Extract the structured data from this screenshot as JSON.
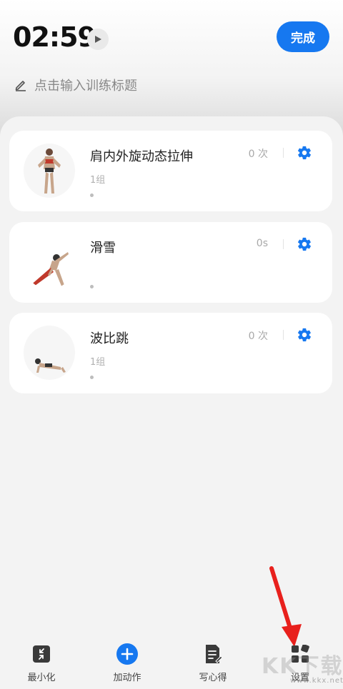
{
  "header": {
    "timer": "02:59",
    "done_label": "完成",
    "title_placeholder": "点击输入训练标题"
  },
  "exercises": [
    {
      "name": "肩内外旋动态拉伸",
      "sets": "1组",
      "count": "0 次"
    },
    {
      "name": "滑雪",
      "sets": "",
      "count": "0s"
    },
    {
      "name": "波比跳",
      "sets": "1组",
      "count": "0 次"
    }
  ],
  "bottom_nav": [
    {
      "label": "最小化",
      "icon": "minimize-icon"
    },
    {
      "label": "加动作",
      "icon": "add-circle-icon"
    },
    {
      "label": "写心得",
      "icon": "notes-icon"
    },
    {
      "label": "设置",
      "icon": "settings-grid-icon"
    }
  ],
  "colors": {
    "accent": "#1678f0",
    "annotation_arrow": "#e8201c"
  },
  "watermark": {
    "text": "KK下载",
    "sub": "www.kkx.net"
  }
}
